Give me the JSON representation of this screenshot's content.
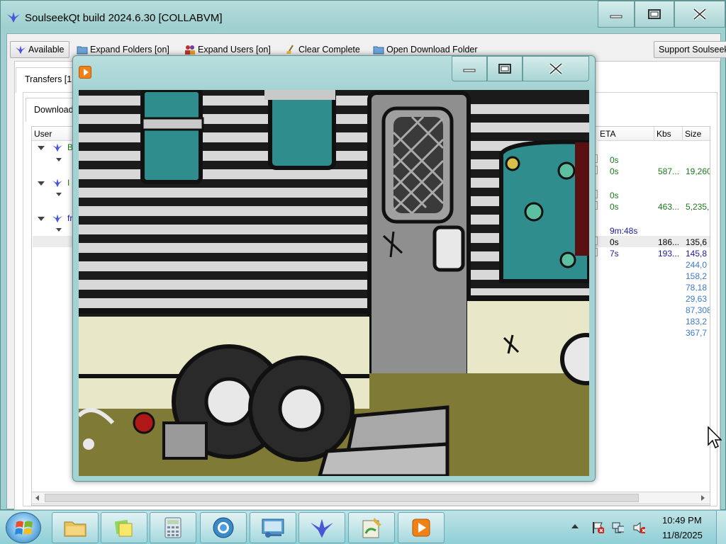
{
  "window": {
    "title": "SoulseekQt build 2024.6.30 [COLLABVM]",
    "icon": "soulseek-bird-icon"
  },
  "toolbar": {
    "available": "Available",
    "expand_folders": "Expand Folders [on]",
    "expand_users": "Expand Users [on]",
    "clear_complete": "Clear Complete",
    "open_download_folder": "Open Download Folder",
    "support": "Support Soulseek"
  },
  "tabs": {
    "transfers": "Transfers [1",
    "downloads": "Download"
  },
  "table": {
    "headers": {
      "user": "User",
      "eta": "ETA",
      "kbs": "Kbs",
      "size": "Size"
    },
    "users": [
      {
        "letter": "B"
      },
      {
        "letter": "I"
      },
      {
        "letter": "fr"
      }
    ],
    "rows": [
      {
        "eta": "0s",
        "kbs": "",
        "size": "",
        "color": "green"
      },
      {
        "eta": "0s",
        "kbs": "587...",
        "size": "19,260",
        "color": "green"
      },
      {
        "eta": "0s",
        "kbs": "",
        "size": "",
        "color": "green"
      },
      {
        "eta": "0s",
        "kbs": "463...",
        "size": "5,235,",
        "color": "green"
      },
      {
        "eta": "9m:48s",
        "kbs": "",
        "size": "",
        "color": "blue"
      },
      {
        "eta": "0s",
        "kbs": "186...",
        "size": "135,6",
        "color": "black"
      },
      {
        "eta": "7s",
        "kbs": "193...",
        "size": "145,8",
        "color": "blue"
      }
    ],
    "pending_sizes": [
      "244,0",
      "158,2",
      "78,18",
      "29,63",
      "87,308",
      "183,2",
      "367,7"
    ]
  },
  "player": {
    "icon": "media-player-icon",
    "video": "animated-trailer-scene"
  },
  "taskbar": {
    "apps": [
      "explorer-folder-icon",
      "sticky-notes-icon",
      "calculator-icon",
      "browser-icon",
      "control-panel-icon",
      "soulseek-icon",
      "paint-icon",
      "media-player-icon"
    ],
    "time": "10:49 PM",
    "date": "11/8/2025"
  }
}
